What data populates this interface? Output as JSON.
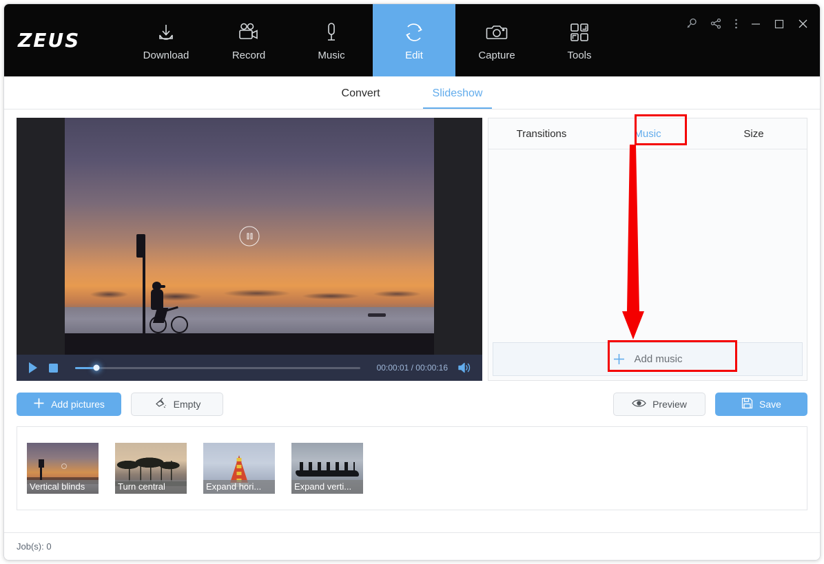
{
  "app": {
    "logo": "ZEUS",
    "nav": [
      {
        "label": "Download",
        "icon": "download-icon",
        "active": false
      },
      {
        "label": "Record",
        "icon": "video-camera-icon",
        "active": false
      },
      {
        "label": "Music",
        "icon": "microphone-icon",
        "active": false
      },
      {
        "label": "Edit",
        "icon": "refresh-cycle-icon",
        "active": true
      },
      {
        "label": "Capture",
        "icon": "camera-icon",
        "active": false
      },
      {
        "label": "Tools",
        "icon": "grid-squares-icon",
        "active": false
      }
    ],
    "window_controls": [
      {
        "name": "search-icon",
        "glyph": "search"
      },
      {
        "name": "share-icon",
        "glyph": "share"
      },
      {
        "name": "more-options-icon",
        "glyph": "dots"
      },
      {
        "name": "minimize-button",
        "glyph": "minimize"
      },
      {
        "name": "maximize-button",
        "glyph": "maximize"
      },
      {
        "name": "close-button",
        "glyph": "close"
      }
    ],
    "accent_color": "#62acec",
    "header_bg": "#080808",
    "annotation_color": "#f40000"
  },
  "subtabs": [
    {
      "label": "Convert",
      "active": false
    },
    {
      "label": "Slideshow",
      "active": true
    }
  ],
  "player": {
    "play_label": "Play",
    "stop_label": "Stop",
    "pause_overlay_label": "Pause",
    "current_time": "00:00:01",
    "total_time": "00:00:16",
    "time_display": "00:00:01 / 00:00:16",
    "progress_percent": 7.5,
    "volume_label": "Volume"
  },
  "right_panel": {
    "tabs": [
      {
        "label": "Transitions",
        "active": false,
        "highlighted": false
      },
      {
        "label": "Music",
        "active": true,
        "highlighted": true
      },
      {
        "label": "Size",
        "active": false,
        "highlighted": false
      }
    ],
    "add_music": {
      "label": "Add music",
      "plus": "+",
      "highlighted": true
    },
    "list_items": []
  },
  "actions": {
    "add_pictures": {
      "label": "Add pictures",
      "plus": "+"
    },
    "empty": {
      "label": "Empty",
      "icon": "broom-icon"
    },
    "preview": {
      "label": "Preview",
      "icon": "eye-icon"
    },
    "save": {
      "label": "Save",
      "icon": "floppy-disk-icon"
    }
  },
  "thumbnails": [
    {
      "caption": "Vertical blinds"
    },
    {
      "caption": "Turn central"
    },
    {
      "caption": "Expand hori..."
    },
    {
      "caption": "Expand verti..."
    }
  ],
  "status": {
    "jobs": "Job(s): 0"
  }
}
